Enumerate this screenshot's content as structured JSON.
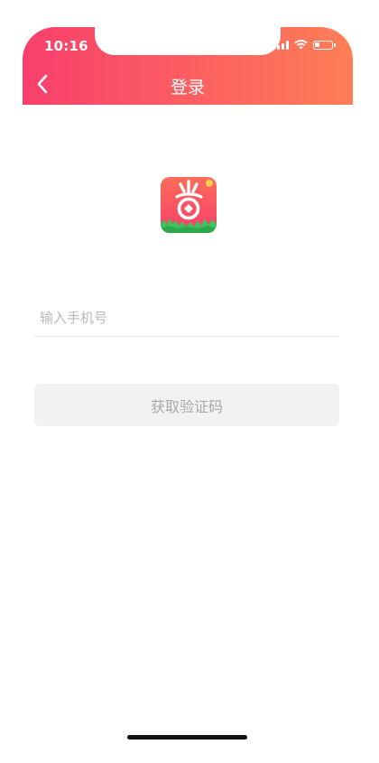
{
  "status_bar": {
    "time": "10:16",
    "icons": [
      "signal-icon",
      "wifi-icon",
      "battery-icon"
    ]
  },
  "nav": {
    "title": "登录",
    "back_icon": "chevron-left-icon"
  },
  "logo": {
    "glyph": "省",
    "colors": {
      "top": "#fd6d5a",
      "bottom": "#f53e6a",
      "grass": "#3cc45c"
    }
  },
  "form": {
    "phone_placeholder": "输入手机号",
    "phone_value": "",
    "get_code_label": "获取验证码"
  },
  "colors": {
    "header_start": "#f83f6b",
    "header_end": "#fd7e55",
    "button_bg": "#f2f2f2",
    "button_text": "#a8a8a8"
  }
}
